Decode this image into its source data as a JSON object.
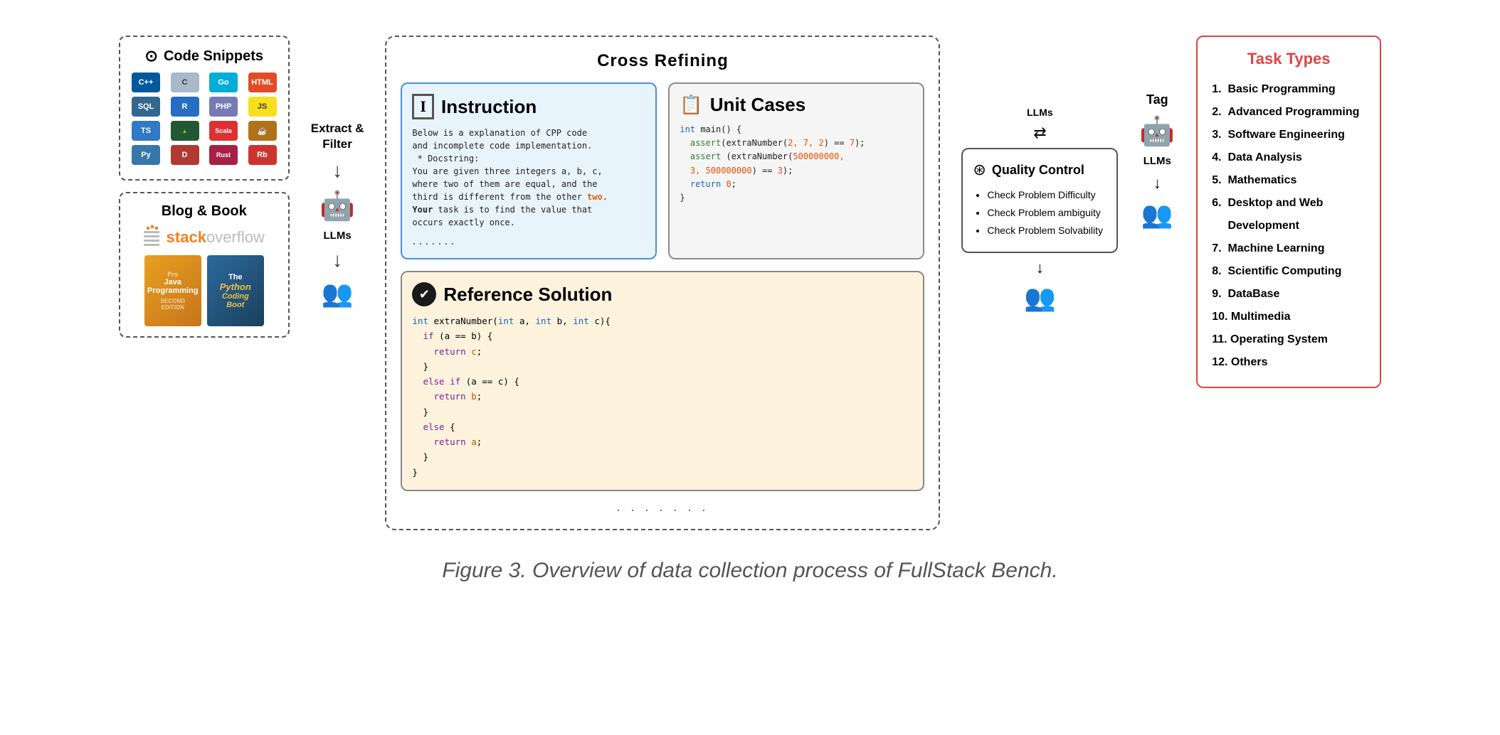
{
  "diagram": {
    "cross_refining_title": "Cross Refining",
    "left": {
      "code_snippets_title": "Code Snippets",
      "blog_book_title": "Blog & Book",
      "languages": [
        {
          "label": "C++",
          "class": "icon-cpp"
        },
        {
          "label": "C",
          "class": "icon-c"
        },
        {
          "label": "Go",
          "class": "icon-go"
        },
        {
          "label": "HTML",
          "class": "icon-html"
        },
        {
          "label": "SQL",
          "class": "icon-sql"
        },
        {
          "label": "R",
          "class": "icon-r"
        },
        {
          "label": "PHP",
          "class": "icon-php"
        },
        {
          "label": "JS",
          "class": "icon-js"
        },
        {
          "label": "TS",
          "class": "icon-ts"
        },
        {
          "label": "●",
          "class": "icon-nodejs"
        },
        {
          "label": "Scala",
          "class": "icon-scala"
        },
        {
          "label": "☕",
          "class": "icon-java"
        },
        {
          "label": "Py",
          "class": "icon-py"
        },
        {
          "label": "D",
          "class": "icon-d"
        },
        {
          "label": "R",
          "class": "icon-rust"
        },
        {
          "label": "Rb",
          "class": "icon-rb"
        }
      ]
    },
    "extract_filter_label": "Extract &\nFilter",
    "llms_label_left": "LLMs",
    "llms_label_right": "LLMs",
    "tag_label": "Tag",
    "instruction": {
      "title": "Instruction",
      "body_line1": "Below is a explanation of CPP code",
      "body_line2": "and incomplete code implementation.",
      "body_line3": " * Docstring:",
      "body_line4": "You are given three integers a, b, c,",
      "body_line5": "where two of them are equal, and the",
      "body_line6": "third is different from the other two.",
      "body_line7": "Your task is to find the value that",
      "body_line8": "occurs exactly once.",
      "dots": "......."
    },
    "unit_cases": {
      "title": "Unit Cases",
      "code_line1": "int main() {",
      "code_line2": "  assert(extraNumber(2, 7, 2) == 7);",
      "code_line3": "  assert (extraNumber(500000000,",
      "code_line4": "  3, 500000000) == 3);",
      "code_line5": "  return 0;",
      "code_line6": "}"
    },
    "reference": {
      "title": "Reference Solution",
      "code_line1": "int extraNumber(int a, int b, int c){",
      "code_line2": "  if (a == b) {",
      "code_line3": "    return c;",
      "code_line4": "  }",
      "code_line5": "  else if (a == c) {",
      "code_line6": "    return b;",
      "code_line7": "  }",
      "code_line8": "  else {",
      "code_line9": "    return a;",
      "code_line10": "  }",
      "code_line11": "}",
      "dots": "......."
    },
    "quality_control": {
      "title": "Quality Control",
      "items": [
        "Check Problem Difficulty",
        "Check Problem ambiguity",
        "Check Problem Solvability"
      ]
    },
    "task_types": {
      "title": "Task Types",
      "items": [
        "1.  Basic Programming",
        "2.  Advanced Programming",
        "3.  Software Engineering",
        "4.  Data Analysis",
        "5.  Mathematics",
        "6.  Desktop and Web Development",
        "7.  Machine Learning",
        "8.  Scientific Computing",
        "9.  DataBase",
        "10. Multimedia",
        "11. Operating System",
        "12. Others"
      ]
    }
  },
  "caption": "Figure 3. Overview of data collection process of FullStack Bench."
}
